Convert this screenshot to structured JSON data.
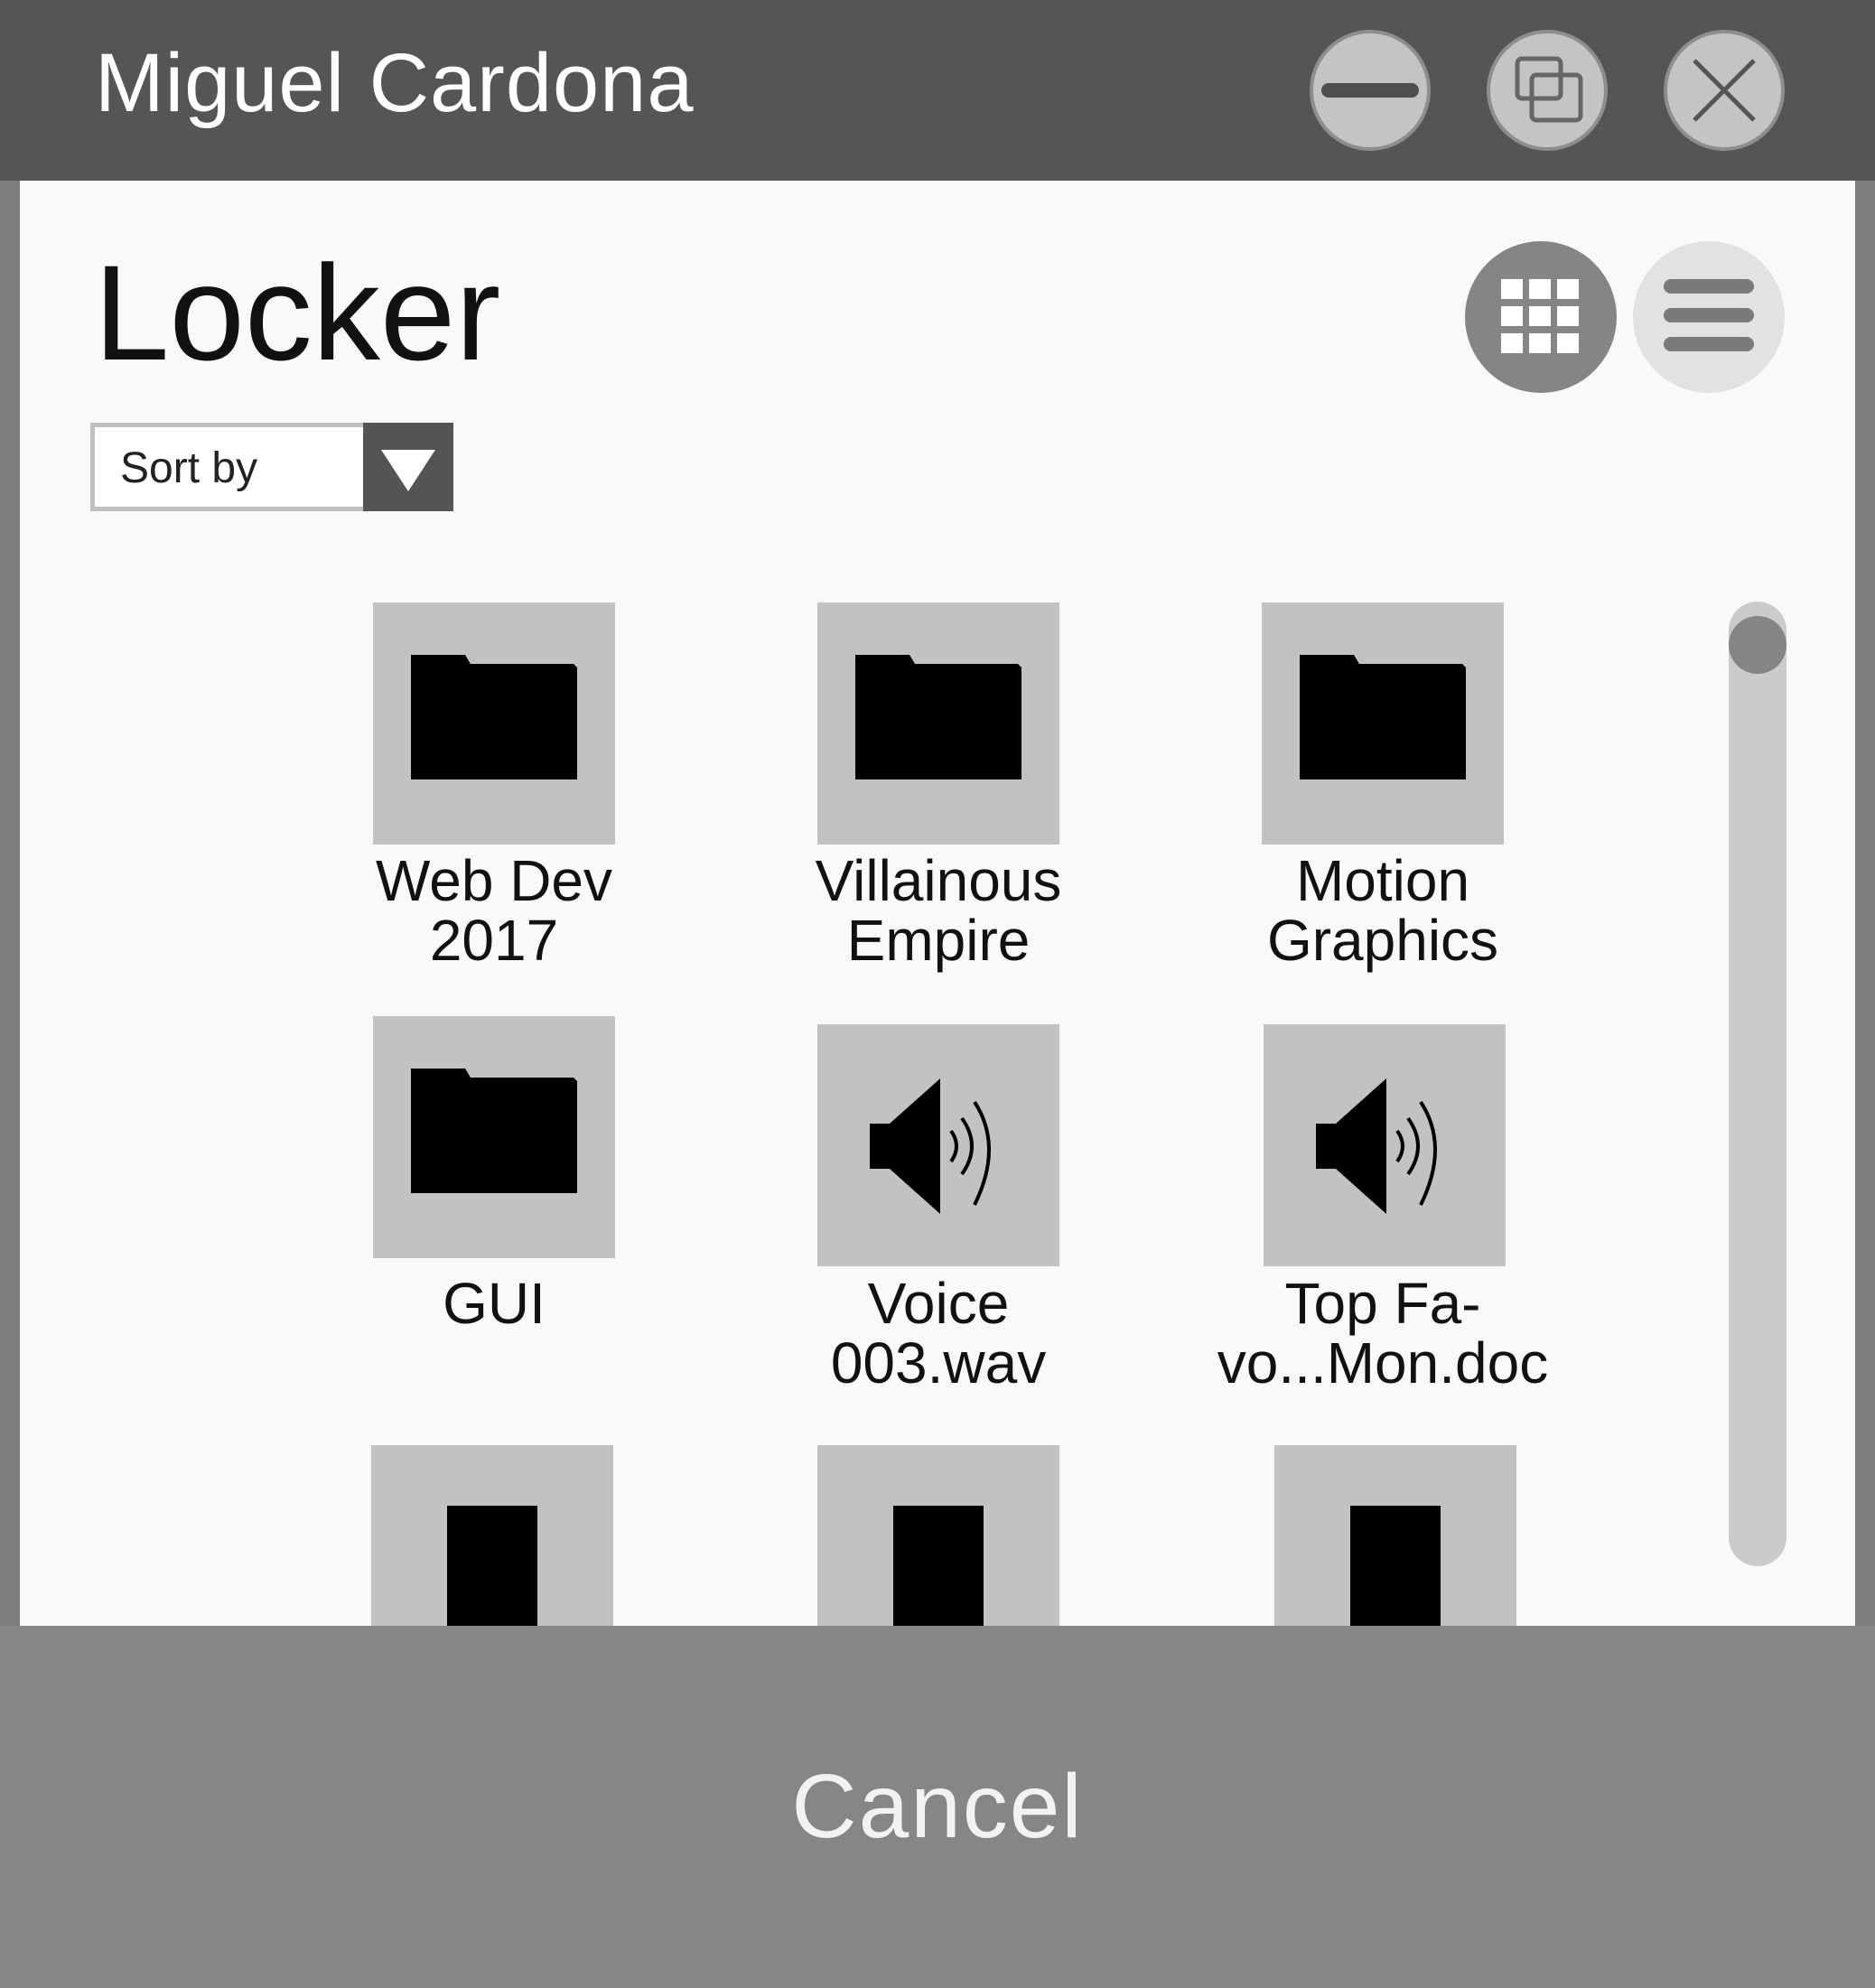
{
  "window": {
    "title": "Miguel Cardona"
  },
  "titlebar_buttons": {
    "minimize": "minimize-icon",
    "restore": "restore-icon",
    "close": "close-icon"
  },
  "page": {
    "title": "Locker"
  },
  "view_toggle": {
    "grid": "grid-view-icon",
    "list": "list-view-icon",
    "active": "grid"
  },
  "sort": {
    "label": "Sort by"
  },
  "items": [
    {
      "type": "folder",
      "line1": "Web Dev",
      "line2": "2017"
    },
    {
      "type": "folder",
      "line1": "Villainous",
      "line2": "Empire"
    },
    {
      "type": "folder",
      "line1": "Motion",
      "line2": "Graphics"
    },
    {
      "type": "folder",
      "line1": "GUI",
      "line2": ""
    },
    {
      "type": "audio",
      "line1": "Voice",
      "line2": "003.wav"
    },
    {
      "type": "audio",
      "line1": "Top Fa-",
      "line2": "vo...Mon.doc"
    },
    {
      "type": "file",
      "line1": "",
      "line2": ""
    },
    {
      "type": "file",
      "line1": "",
      "line2": ""
    },
    {
      "type": "file",
      "line1": "",
      "line2": ""
    }
  ],
  "footer": {
    "cancel_label": "Cancel"
  },
  "colors": {
    "titlebar": "#555555",
    "content": "#f9f9f9",
    "tile": "#c2c2c2",
    "footer": "#868686"
  }
}
